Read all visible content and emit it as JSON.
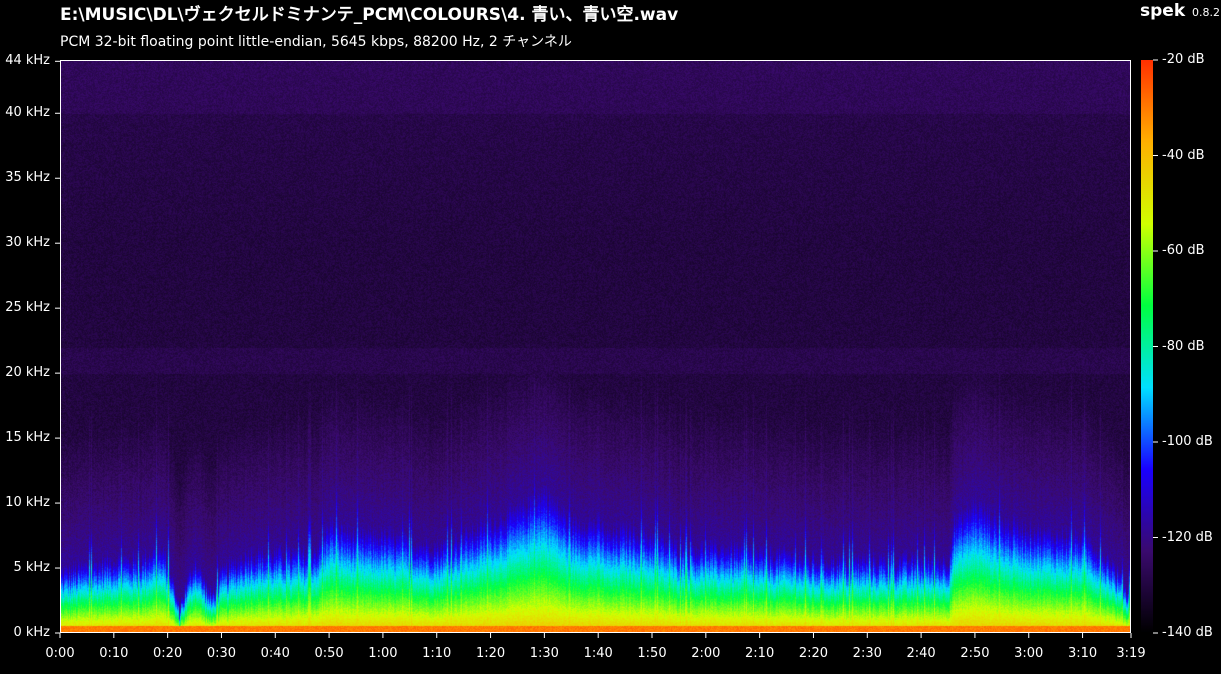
{
  "header": {
    "file_path": "E:\\MUSIC\\DL\\ヴェクセルドミナンテ_PCM\\COLOURS\\4. 青い、青い空.wav",
    "file_info": "PCM 32-bit floating point little-endian, 5645 kbps, 88200 Hz, 2 チャンネル",
    "app_name": "spek",
    "app_version": "0.8.2"
  },
  "chart_data": {
    "type": "heatmap",
    "title": "",
    "xlabel": "",
    "ylabel": "",
    "x_ticks": [
      "0:00",
      "0:10",
      "0:20",
      "0:30",
      "0:40",
      "0:50",
      "1:00",
      "1:10",
      "1:20",
      "1:30",
      "1:40",
      "1:50",
      "2:00",
      "2:10",
      "2:20",
      "2:30",
      "2:40",
      "2:50",
      "3:00",
      "3:10",
      "3:19"
    ],
    "x_range_seconds": [
      0,
      199
    ],
    "y_ticks": [
      "0 kHz",
      "5 kHz",
      "10 kHz",
      "15 kHz",
      "20 kHz",
      "25 kHz",
      "30 kHz",
      "35 kHz",
      "40 kHz",
      "44 kHz"
    ],
    "y_range_khz": [
      0,
      44.1
    ],
    "colorbar_ticks": [
      "-20 dB",
      "-40 dB",
      "-60 dB",
      "-80 dB",
      "-100 dB",
      "-120 dB",
      "-140 dB"
    ],
    "colorbar_range_db": [
      -140,
      -20
    ],
    "colormap": [
      "#000000",
      "#3a0a6e",
      "#1a00ff",
      "#00e0ff",
      "#00ff40",
      "#d0ff00",
      "#ffb000",
      "#ff3000"
    ],
    "background_level_db": -130,
    "energy_profile": {
      "description_level": "upper frequency extent (kHz) of energy over time",
      "time_seconds": [
        0,
        5,
        10,
        15,
        18,
        20,
        22,
        25,
        28,
        30,
        35,
        40,
        45,
        48,
        50,
        55,
        60,
        65,
        70,
        75,
        80,
        85,
        88,
        90,
        95,
        100,
        102,
        105,
        110,
        115,
        120,
        125,
        130,
        135,
        140,
        145,
        150,
        155,
        160,
        165,
        166,
        170,
        175,
        180,
        185,
        190,
        195,
        199
      ],
      "top_khz": [
        5,
        5.5,
        6,
        6,
        7,
        6,
        2,
        6,
        3,
        5,
        6.5,
        6.5,
        6.5,
        7,
        9,
        8,
        8,
        7.5,
        7,
        8,
        9,
        10,
        11,
        11.5,
        9,
        9,
        8,
        8.5,
        8,
        7,
        7,
        7,
        6.5,
        6.5,
        6,
        6,
        6,
        6,
        6,
        6,
        9,
        10.5,
        9,
        8.5,
        8,
        8,
        6,
        3
      ]
    }
  }
}
